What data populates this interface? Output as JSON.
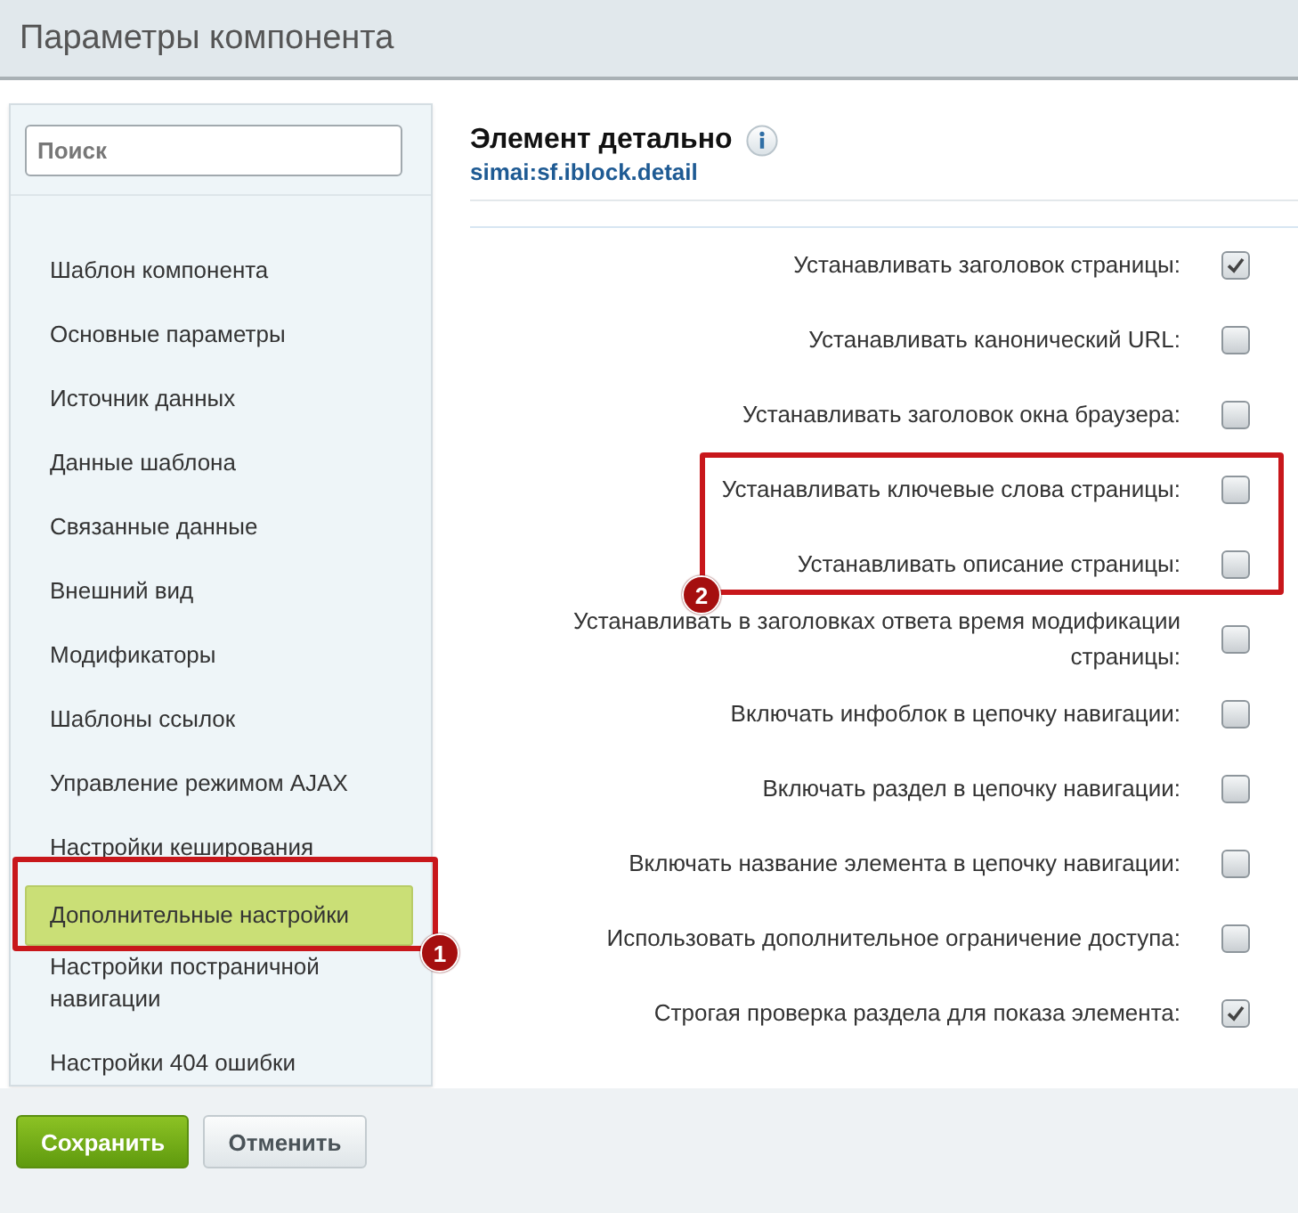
{
  "window": {
    "title": "Параметры компонента"
  },
  "sidebar": {
    "search": {
      "placeholder": "Поиск"
    },
    "items": [
      {
        "label": "Шаблон компонента",
        "selected": false
      },
      {
        "label": "Основные параметры",
        "selected": false
      },
      {
        "label": "Источник данных",
        "selected": false
      },
      {
        "label": "Данные шаблона",
        "selected": false
      },
      {
        "label": "Связанные данные",
        "selected": false
      },
      {
        "label": "Внешний вид",
        "selected": false
      },
      {
        "label": "Модификаторы",
        "selected": false
      },
      {
        "label": "Шаблоны ссылок",
        "selected": false
      },
      {
        "label": "Управление режимом AJAX",
        "selected": false
      },
      {
        "label": "Настройки кеширования",
        "selected": false
      },
      {
        "label": "Дополнительные настройки",
        "selected": true,
        "callout": "1"
      },
      {
        "label": "Настройки постраничной навигации",
        "selected": false
      },
      {
        "label": "Настройки 404 ошибки",
        "selected": false
      }
    ]
  },
  "component": {
    "title": "Элемент детально",
    "code": "simai:sf.iblock.detail"
  },
  "settings": [
    {
      "kind": "row",
      "label": "Устанавливать заголовок страницы:",
      "checked": true
    },
    {
      "kind": "row",
      "label": "Устанавливать канонический URL:",
      "checked": false
    },
    {
      "kind": "row",
      "label": "Устанавливать заголовок окна браузера:",
      "checked": false
    },
    {
      "kind": "callout",
      "label": "2",
      "rows": [
        {
          "label": "Устанавливать ключевые слова страницы:",
          "checked": false
        },
        {
          "label": "Устанавливать описание страницы:",
          "checked": false
        }
      ]
    },
    {
      "kind": "row",
      "label": "Устанавливать в заголовках ответа время модификации страницы:",
      "checked": false
    },
    {
      "kind": "row",
      "label": "Включать инфоблок в цепочку навигации:",
      "checked": false
    },
    {
      "kind": "row",
      "label": "Включать раздел в цепочку навигации:",
      "checked": false
    },
    {
      "kind": "row",
      "label": "Включать название элемента в цепочку навигации:",
      "checked": false
    },
    {
      "kind": "row",
      "label": "Использовать дополнительное ограничение доступа:",
      "checked": false
    },
    {
      "kind": "row",
      "label": "Строгая проверка раздела для показа элемента:",
      "checked": true
    }
  ],
  "buttons": [
    {
      "label": "Сохранить",
      "kind": "primary"
    },
    {
      "label": "Отменить",
      "kind": "secondary"
    }
  ]
}
